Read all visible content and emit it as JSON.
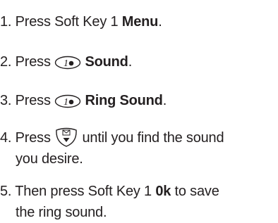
{
  "steps": [
    {
      "number": "1.",
      "text": "Press Soft Key 1",
      "bold": "Menu",
      "tail": "."
    },
    {
      "number": "2.",
      "text": "Press",
      "key_icon": "key-1-icon",
      "key_label": "1",
      "bold": "Sound",
      "tail": "."
    },
    {
      "number": "3.",
      "text": "Press",
      "key_icon": "key-1-icon",
      "key_label": "1",
      "bold": "Ring Sound",
      "tail": "."
    },
    {
      "number": "4.",
      "text": "Press",
      "key_icon": "navigation-down-key-icon",
      "after": "until you find the sound",
      "continuation": "you desire."
    },
    {
      "number": "5.",
      "text": "Then press Soft Key 1",
      "bold": "0k",
      "after": "to save",
      "continuation": "the ring sound."
    }
  ]
}
